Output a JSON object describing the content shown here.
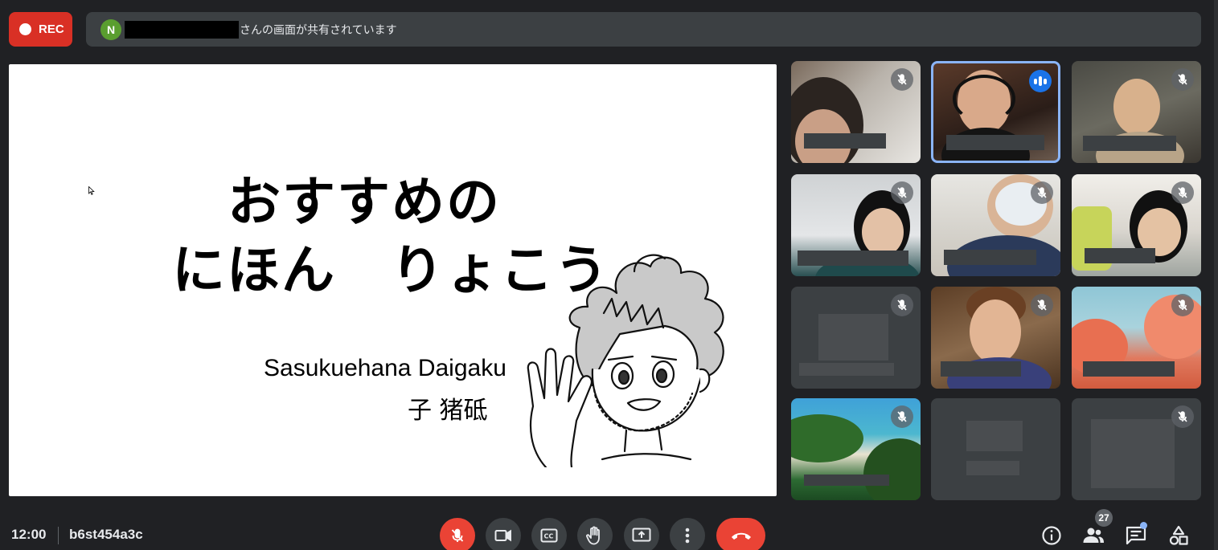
{
  "recording": {
    "label": "REC"
  },
  "share_banner": {
    "presenter_initial": "N",
    "text": "さんの画面が共有されています"
  },
  "slide": {
    "title_line1": "おすすめの",
    "title_line2": "にほん　りょこう",
    "school": "Sasukuehana Daigaku",
    "teacher": "子 猪砥"
  },
  "participants": [
    {
      "row": 1,
      "col": 1,
      "muted": true,
      "speaking": false,
      "video": "camera"
    },
    {
      "row": 1,
      "col": 2,
      "muted": false,
      "speaking": true,
      "video": "camera"
    },
    {
      "row": 1,
      "col": 3,
      "muted": true,
      "speaking": false,
      "video": "camera"
    },
    {
      "row": 2,
      "col": 1,
      "muted": true,
      "speaking": false,
      "video": "camera"
    },
    {
      "row": 2,
      "col": 2,
      "muted": true,
      "speaking": false,
      "video": "camera"
    },
    {
      "row": 2,
      "col": 3,
      "muted": true,
      "speaking": false,
      "video": "camera"
    },
    {
      "row": 3,
      "col": 1,
      "muted": true,
      "speaking": false,
      "video": "off"
    },
    {
      "row": 3,
      "col": 2,
      "muted": true,
      "speaking": false,
      "video": "camera"
    },
    {
      "row": 3,
      "col": 3,
      "muted": true,
      "speaking": false,
      "video": "camera"
    },
    {
      "row": 4,
      "col": 1,
      "muted": true,
      "speaking": false,
      "video": "camera"
    },
    {
      "row": 4,
      "col": 2,
      "muted": false,
      "speaking": false,
      "video": "off"
    },
    {
      "row": 4,
      "col": 3,
      "muted": true,
      "speaking": false,
      "video": "off"
    }
  ],
  "bottom_bar": {
    "time": "12:00",
    "meeting_code": "b6st454a3c",
    "controls": [
      "mic-off-icon",
      "camera-icon",
      "captions-icon",
      "raise-hand-icon",
      "present-icon",
      "more-options-icon",
      "end-call-icon"
    ],
    "people_count": "27",
    "right_icons": [
      "info-icon",
      "people-icon",
      "chat-icon",
      "activities-icon"
    ]
  },
  "colors": {
    "rec": "#d93025",
    "end_call": "#ea4335",
    "speaking": "#1a73e8",
    "active_border": "#8ab4f8",
    "background": "#202124"
  }
}
